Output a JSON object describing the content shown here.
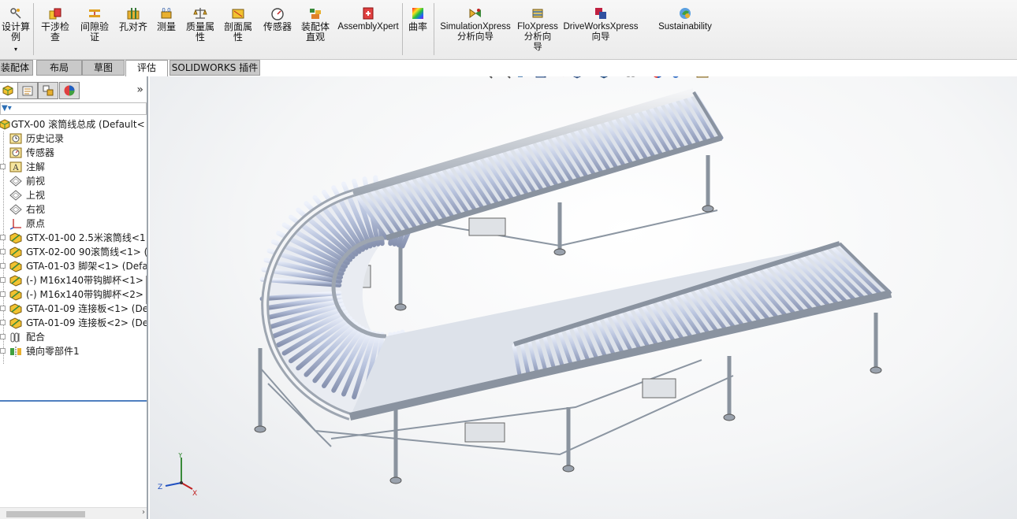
{
  "ribbon": {
    "items": [
      {
        "label": "设计算\n例"
      },
      {
        "label": "干涉检\n查"
      },
      {
        "label": "间隙验\n证"
      },
      {
        "label": "孔对齐"
      },
      {
        "label": "测量"
      },
      {
        "label": "质量属\n性"
      },
      {
        "label": "剖面属\n性"
      },
      {
        "label": "传感器"
      },
      {
        "label": "装配体\n直观"
      },
      {
        "label": "AssemblyXpert"
      },
      {
        "label": "曲率"
      },
      {
        "label": "SimulationXpress\n分析向导"
      },
      {
        "label": "FloXpress\n分析向\n导"
      },
      {
        "label": "DriveWorksXpress\n向导"
      },
      {
        "label": "Sustainability"
      }
    ]
  },
  "tabs": [
    {
      "label": "装配体"
    },
    {
      "label": "布局"
    },
    {
      "label": "草图"
    },
    {
      "label": "评估"
    },
    {
      "label": "SOLIDWORKS 插件"
    }
  ],
  "active_tab": "评估",
  "feature_tree": {
    "more": "»",
    "root": "GTX-00  滚筒线总成  (Default<",
    "items": [
      {
        "label": "历史记录"
      },
      {
        "label": "传感器"
      },
      {
        "label": "注解"
      },
      {
        "label": "前视"
      },
      {
        "label": "上视"
      },
      {
        "label": "右视"
      },
      {
        "label": "原点"
      },
      {
        "label": "GTX-01-00   2.5米滚筒线<1"
      },
      {
        "label": "GTX-02-00   90滚筒线<1> ("
      },
      {
        "label": "GTA-01-03   脚架<1>  (Defa"
      },
      {
        "label": "(-) M16x140带钩脚杯<1>  ("
      },
      {
        "label": "(-) M16x140带钩脚杯<2>  ("
      },
      {
        "label": "GTA-01-09   连接板<1>  (De"
      },
      {
        "label": "GTA-01-09   连接板<2>  (De"
      },
      {
        "label": "配合"
      },
      {
        "label": "镜向零部件1"
      }
    ]
  },
  "triad": {
    "x": "X",
    "y": "Y",
    "z": "Z"
  },
  "colors": {
    "tree_end": "#4f7fc0",
    "frame": "#8c96a2",
    "roller": "#b9c4de"
  }
}
